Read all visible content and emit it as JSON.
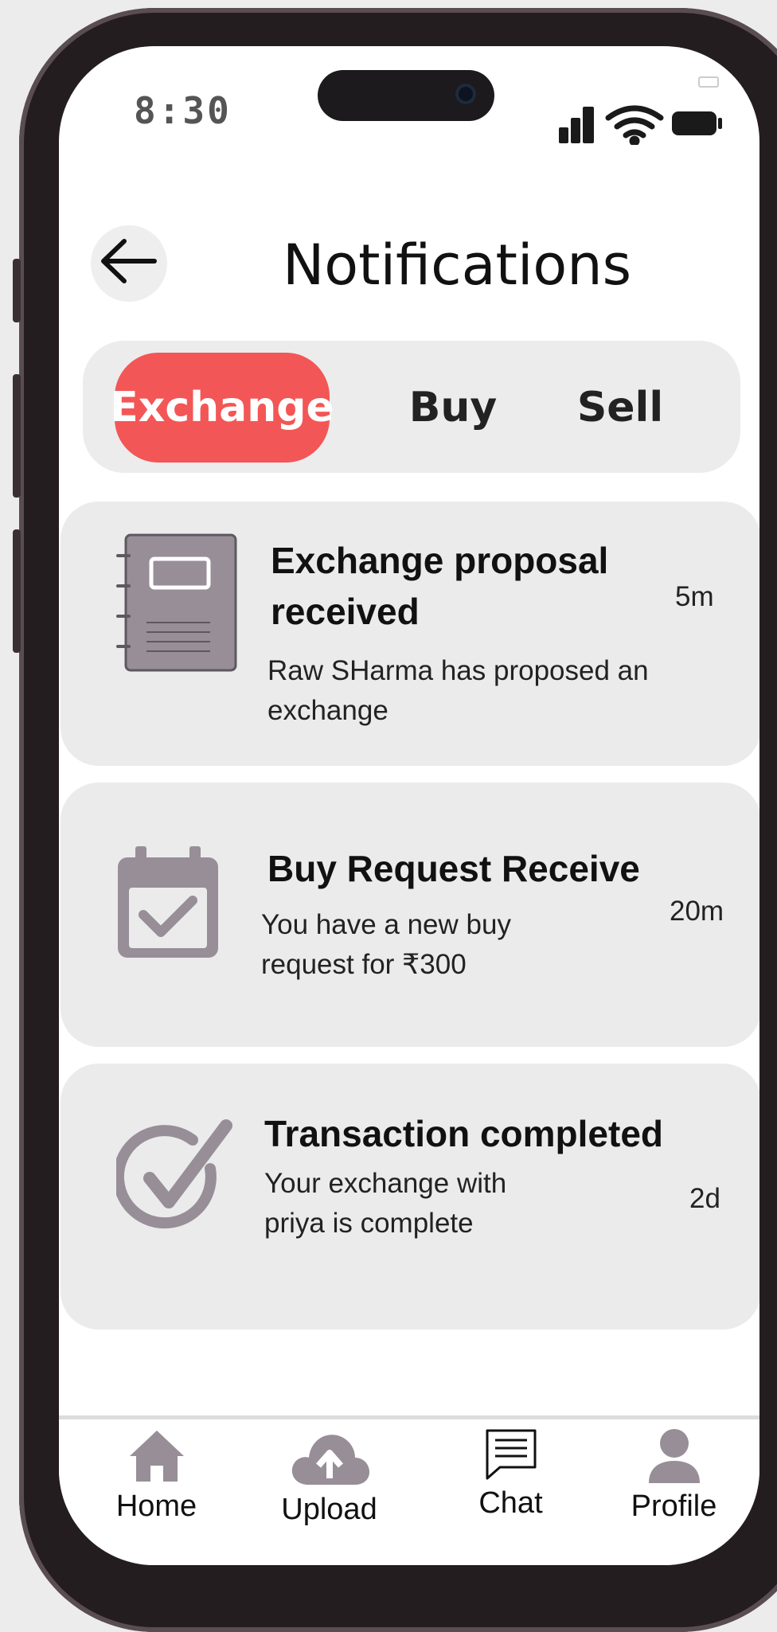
{
  "status_bar": {
    "time": "8:30"
  },
  "header": {
    "title": "Notifications",
    "back_icon": "arrow-left-icon"
  },
  "tabs": [
    {
      "label": "Exchange",
      "active": true
    },
    {
      "label": "Buy",
      "active": false
    },
    {
      "label": "Sell",
      "active": false
    }
  ],
  "notifications": [
    {
      "icon": "notebook-icon",
      "title_line1": "Exchange proposal",
      "title_line2": "received",
      "message_line1": "Raw SHarma has proposed an",
      "message_line2": "exchange",
      "time": "5m"
    },
    {
      "icon": "calendar-check-icon",
      "title_line1": "Buy Request Receive",
      "message_line1": "You have a new buy",
      "message_line2": "request for ₹300",
      "time": "20m"
    },
    {
      "icon": "check-circle-icon",
      "title_line1": "Transaction completed",
      "message_line1": "Your exchange with",
      "message_line2": "priya is complete",
      "time": "2d"
    }
  ],
  "nav": [
    {
      "label": "Home",
      "icon": "home-icon"
    },
    {
      "label": "Upload",
      "icon": "cloud-upload-icon"
    },
    {
      "label": "Chat",
      "icon": "chat-icon"
    },
    {
      "label": "Profile",
      "icon": "profile-icon"
    }
  ],
  "colors": {
    "accent": "#f35656",
    "icon_gray": "#978e98",
    "card_bg": "#ebebeb"
  }
}
